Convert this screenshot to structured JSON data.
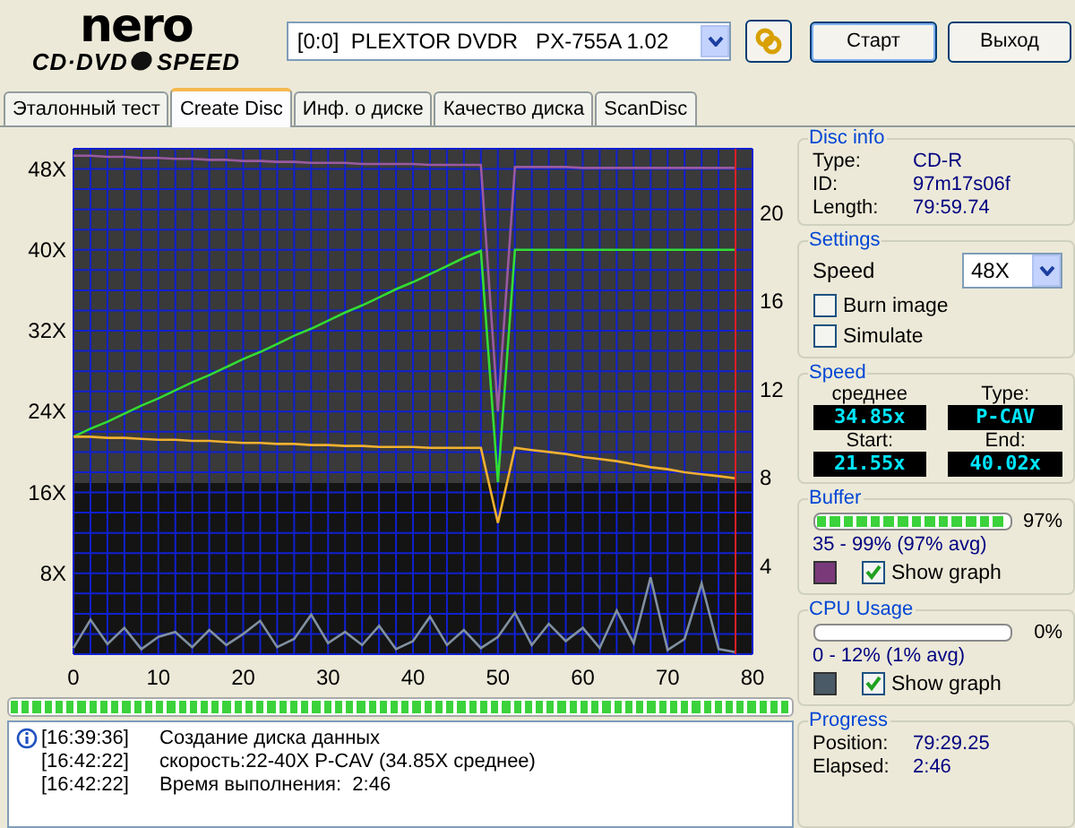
{
  "logo": {
    "brand": "nero",
    "left": "CD·DVD",
    "right": "SPEED"
  },
  "header": {
    "drive": "[0:0]  PLEXTOR DVDR   PX-755A 1.02",
    "buttons": [
      "Старт",
      "Выход"
    ]
  },
  "tabs": [
    {
      "label": "Эталонный тест",
      "selected": false
    },
    {
      "label": "Create Disc",
      "selected": true
    },
    {
      "label": "Инф. о диске",
      "selected": false
    },
    {
      "label": "Качество диска",
      "selected": false
    },
    {
      "label": "ScanDisc",
      "selected": false
    }
  ],
  "graph": {
    "right_axis_ticks": [
      "20",
      "16",
      "12",
      "8",
      "4"
    ],
    "chart_data": {
      "type": "line",
      "grid": true,
      "bands": [
        {
          "axis": "y",
          "from": 17,
          "to": 50,
          "color": "#3a3a3a"
        },
        {
          "axis": "y",
          "from": 0,
          "to": 17,
          "color": "#141414"
        }
      ],
      "ref_lines": [
        {
          "axis": "x",
          "value": 78,
          "color": "#e02020"
        }
      ],
      "x": [
        0,
        2,
        4,
        6,
        8,
        10,
        12,
        14,
        16,
        18,
        20,
        22,
        24,
        26,
        28,
        30,
        32,
        34,
        36,
        38,
        40,
        42,
        44,
        46,
        48,
        50,
        52,
        54,
        56,
        58,
        60,
        62,
        64,
        66,
        68,
        70,
        72,
        74,
        76,
        78
      ],
      "xlim": [
        0,
        80
      ],
      "ylim": [
        0,
        50
      ],
      "xticks": [
        0,
        10,
        20,
        30,
        40,
        50,
        60,
        70,
        80
      ],
      "yticks": [
        {
          "value": 8,
          "label": "8X"
        },
        {
          "value": 16,
          "label": "16X"
        },
        {
          "value": 24,
          "label": "24X"
        },
        {
          "value": 32,
          "label": "32X"
        },
        {
          "value": 40,
          "label": "40X"
        },
        {
          "value": 48,
          "label": "48X"
        }
      ],
      "series": [
        {
          "color": "#33dd33",
          "values": [
            21.5,
            22.3,
            23.0,
            23.8,
            24.6,
            25.3,
            26.1,
            26.9,
            27.6,
            28.4,
            29.2,
            29.9,
            30.7,
            31.5,
            32.2,
            33.0,
            33.8,
            34.5,
            35.3,
            36.1,
            36.8,
            37.6,
            38.4,
            39.2,
            39.9,
            17,
            40,
            40,
            40,
            40,
            40,
            40,
            40,
            40,
            40,
            40,
            40,
            40,
            40,
            40
          ]
        },
        {
          "color": "#f0b030",
          "values": [
            21.5,
            21.5,
            21.4,
            21.4,
            21.3,
            21.2,
            21.2,
            21.1,
            21.1,
            21.0,
            20.9,
            20.9,
            20.8,
            20.8,
            20.7,
            20.7,
            20.6,
            20.6,
            20.5,
            20.5,
            20.5,
            20.4,
            20.4,
            20.4,
            20.4,
            13,
            20.4,
            20.2,
            20.0,
            19.8,
            19.5,
            19.3,
            19.1,
            18.8,
            18.5,
            18.3,
            18.0,
            17.8,
            17.6,
            17.4
          ]
        },
        {
          "color": "#9a5aa0",
          "values": [
            49.3,
            49.3,
            49.2,
            49.2,
            49.1,
            49.1,
            49.0,
            49.0,
            48.9,
            48.9,
            48.8,
            48.8,
            48.7,
            48.7,
            48.6,
            48.6,
            48.6,
            48.5,
            48.5,
            48.5,
            48.5,
            48.4,
            48.4,
            48.4,
            48.4,
            24,
            48.2,
            48.2,
            48.2,
            48.2,
            48.1,
            48.1,
            48.1,
            48.1,
            48.1,
            48.1,
            48.1,
            48.1,
            48.1,
            48.1
          ]
        },
        {
          "color": "#8090a0",
          "values": [
            0.6,
            3.4,
            1.0,
            2.6,
            0.5,
            1.7,
            2.2,
            0.7,
            2.4,
            0.9,
            2.0,
            3.3,
            0.7,
            1.5,
            3.9,
            1.1,
            2.2,
            0.9,
            2.8,
            0.5,
            1.3,
            3.7,
            0.9,
            2.4,
            0.6,
            1.7,
            4.1,
            0.9,
            3.0,
            1.3,
            2.6,
            0.6,
            4.3,
            1.1,
            7.6,
            0.4,
            1.5,
            7.0,
            0.5,
            0.2
          ]
        }
      ]
    }
  },
  "overall_progress": {
    "level": 1
  },
  "log": [
    {
      "kind": "info",
      "time": "[16:39:36]",
      "text": "Создание диска данных"
    },
    {
      "kind": "plain",
      "time": "[16:42:22]",
      "text": "скорость:22-40X P-CAV (34.85X среднее)"
    },
    {
      "kind": "plain",
      "time": "[16:42:22]",
      "text": "Время выполнения:  2:46"
    }
  ],
  "disc_info": {
    "title": "Disc info",
    "fields": [
      {
        "label": "Type:",
        "value": "CD-R"
      },
      {
        "label": "ID:",
        "value": "97m17s06f"
      },
      {
        "label": "Length:",
        "value": "79:59.74"
      }
    ]
  },
  "settings": {
    "title": "Settings",
    "speed_label": "Speed",
    "speed_value": "48X",
    "checkboxes": [
      {
        "label": "Burn image",
        "checked": false
      },
      {
        "label": "Simulate",
        "checked": false
      }
    ]
  },
  "speed": {
    "title": "Speed",
    "readouts": [
      {
        "label": "среднее",
        "value": "34.85x"
      },
      {
        "label": "Type:",
        "value": "P-CAV"
      },
      {
        "label": "Start:",
        "value": "21.55x"
      },
      {
        "label": "End:",
        "value": "40.02x"
      }
    ]
  },
  "buffer": {
    "title": "Buffer",
    "level": 0.97,
    "percent": "97%",
    "range": "35 - 99% (97% avg)",
    "color": "#7a3a7a",
    "show_graph": {
      "label": "Show graph",
      "checked": true
    }
  },
  "cpu": {
    "title": "CPU Usage",
    "percent": "0%",
    "range": "0 - 12% (1% avg)",
    "color": "#4a5a66",
    "show_graph": {
      "label": "Show graph",
      "checked": true
    }
  },
  "progress": {
    "title": "Progress",
    "fields": [
      {
        "label": "Position:",
        "value": "79:29.25"
      },
      {
        "label": "Elapsed:",
        "value": "2:46"
      }
    ]
  }
}
